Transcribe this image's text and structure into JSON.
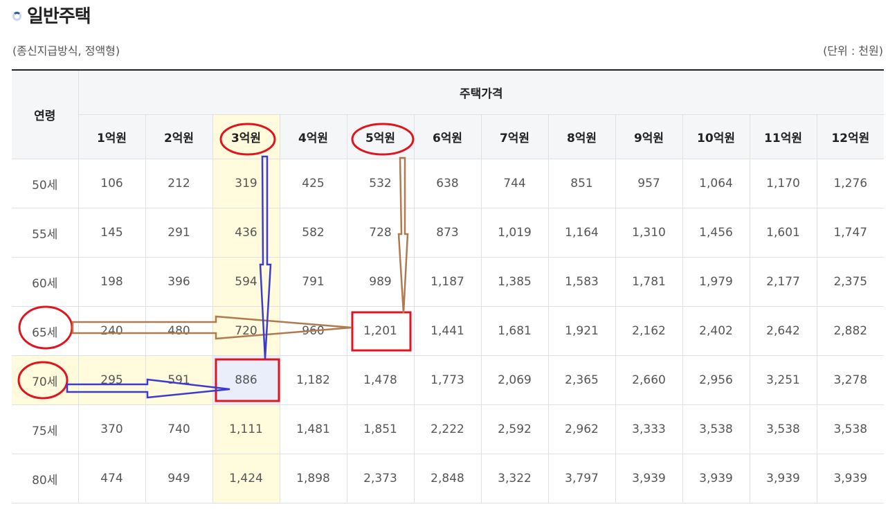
{
  "header": {
    "title": "일반주택",
    "subtitle": "(종신지급방식, 정액형)",
    "unit": "(단위 : 천원)"
  },
  "table": {
    "age_header": "연령",
    "price_header": "주택가격",
    "columns": [
      "1억원",
      "2억원",
      "3억원",
      "4억원",
      "5억원",
      "6억원",
      "7억원",
      "8억원",
      "9억원",
      "10억원",
      "11억원",
      "12억원"
    ],
    "rows": [
      {
        "age": "50세",
        "values": [
          "106",
          "212",
          "319",
          "425",
          "532",
          "638",
          "744",
          "851",
          "957",
          "1,064",
          "1,170",
          "1,276"
        ]
      },
      {
        "age": "55세",
        "values": [
          "145",
          "291",
          "436",
          "582",
          "728",
          "873",
          "1,019",
          "1,164",
          "1,310",
          "1,456",
          "1,601",
          "1,747"
        ]
      },
      {
        "age": "60세",
        "values": [
          "198",
          "396",
          "594",
          "791",
          "989",
          "1,187",
          "1,385",
          "1,583",
          "1,781",
          "1,979",
          "2,177",
          "2,375"
        ]
      },
      {
        "age": "65세",
        "values": [
          "240",
          "480",
          "720",
          "960",
          "1,201",
          "1,441",
          "1,681",
          "1,921",
          "2,162",
          "2,402",
          "2,642",
          "2,882"
        ]
      },
      {
        "age": "70세",
        "values": [
          "295",
          "591",
          "886",
          "1,182",
          "1,478",
          "1,773",
          "2,069",
          "2,365",
          "2,660",
          "2,956",
          "3,251",
          "3,278"
        ]
      },
      {
        "age": "75세",
        "values": [
          "370",
          "740",
          "1,111",
          "1,481",
          "1,851",
          "2,222",
          "2,592",
          "2,962",
          "3,333",
          "3,538",
          "3,538",
          "3,538"
        ]
      },
      {
        "age": "80세",
        "values": [
          "474",
          "949",
          "1,424",
          "1,898",
          "2,373",
          "2,848",
          "3,322",
          "3,797",
          "3,939",
          "3,939",
          "3,939",
          "3,939"
        ]
      }
    ]
  },
  "annotations": {
    "highlight_column_color": "#fffbdc",
    "selected_cell_color": "#e9eefa",
    "red_mark_color": "#e0141e",
    "blue_arrow_color": "#3b3bd0",
    "brown_arrow_color": "#b07a4e"
  }
}
